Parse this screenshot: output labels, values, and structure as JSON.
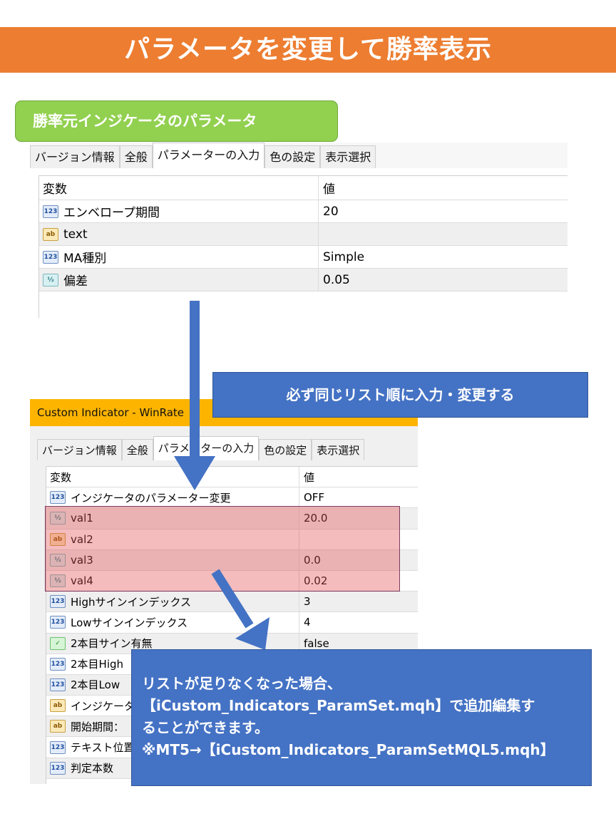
{
  "banner": {
    "title": "パラメータを変更して勝率表示"
  },
  "source_label": "勝率元インジケータのパラメータ",
  "dialog1": {
    "tabs": [
      "バージョン情報",
      "全般",
      "パラメーターの入力",
      "色の設定",
      "表示選択"
    ],
    "active_tab": 2,
    "headers": {
      "variable": "変数",
      "value": "値"
    },
    "rows": [
      {
        "icon": "123",
        "name": "エンベロープ期間",
        "value": "20"
      },
      {
        "icon": "ab",
        "name": "text",
        "value": ""
      },
      {
        "icon": "123",
        "name": "MA種別",
        "value": "Simple"
      },
      {
        "icon": "v2",
        "name": "偏差",
        "value": "0.05"
      }
    ]
  },
  "callout_top": "必ず同じリスト順に入力・変更する",
  "dialog2": {
    "title": "Custom Indicator - WinRate",
    "tabs": [
      "バージョン情報",
      "全般",
      "パラメーターの入力",
      "色の設定",
      "表示選択"
    ],
    "active_tab": 2,
    "headers": {
      "variable": "変数",
      "value": "値"
    },
    "rows": [
      {
        "icon": "123",
        "name": "インジケータのパラメーター変更",
        "value": "OFF"
      },
      {
        "icon": "v2",
        "name": "val1",
        "value": "20.0"
      },
      {
        "icon": "ab",
        "name": "val2",
        "value": ""
      },
      {
        "icon": "v2",
        "name": "val3",
        "value": "0.0"
      },
      {
        "icon": "v2",
        "name": "val4",
        "value": "0.02"
      },
      {
        "icon": "123",
        "name": "Highサインインデックス",
        "value": "3"
      },
      {
        "icon": "123",
        "name": "Lowサインインデックス",
        "value": "4"
      },
      {
        "icon": "bool",
        "name": "2本目サイン有無",
        "value": "false"
      },
      {
        "icon": "123",
        "name": "2本目High",
        "value": ""
      },
      {
        "icon": "123",
        "name": "2本目Low",
        "value": ""
      },
      {
        "icon": "ab",
        "name": "インジケータ名",
        "value": ""
      },
      {
        "icon": "ab",
        "name": "開始期間：",
        "value": ""
      },
      {
        "icon": "123",
        "name": "テキスト位置",
        "value": ""
      },
      {
        "icon": "123",
        "name": "判定本数",
        "value": ""
      }
    ]
  },
  "callout_bottom": {
    "line1": "リストが足りなくなった場合、",
    "line2": "【iCustom_Indicators_ParamSet.mqh】で追加編集す",
    "line3": "ることができます。",
    "line4": "※MT5→【iCustom_Indicators_ParamSetMQL5.mqh】"
  },
  "colors": {
    "banner": "#ed7d31",
    "label_green": "#92d050",
    "callout_blue": "#4472c4",
    "title_bar": "#fcb400",
    "highlight": "#e15050"
  }
}
